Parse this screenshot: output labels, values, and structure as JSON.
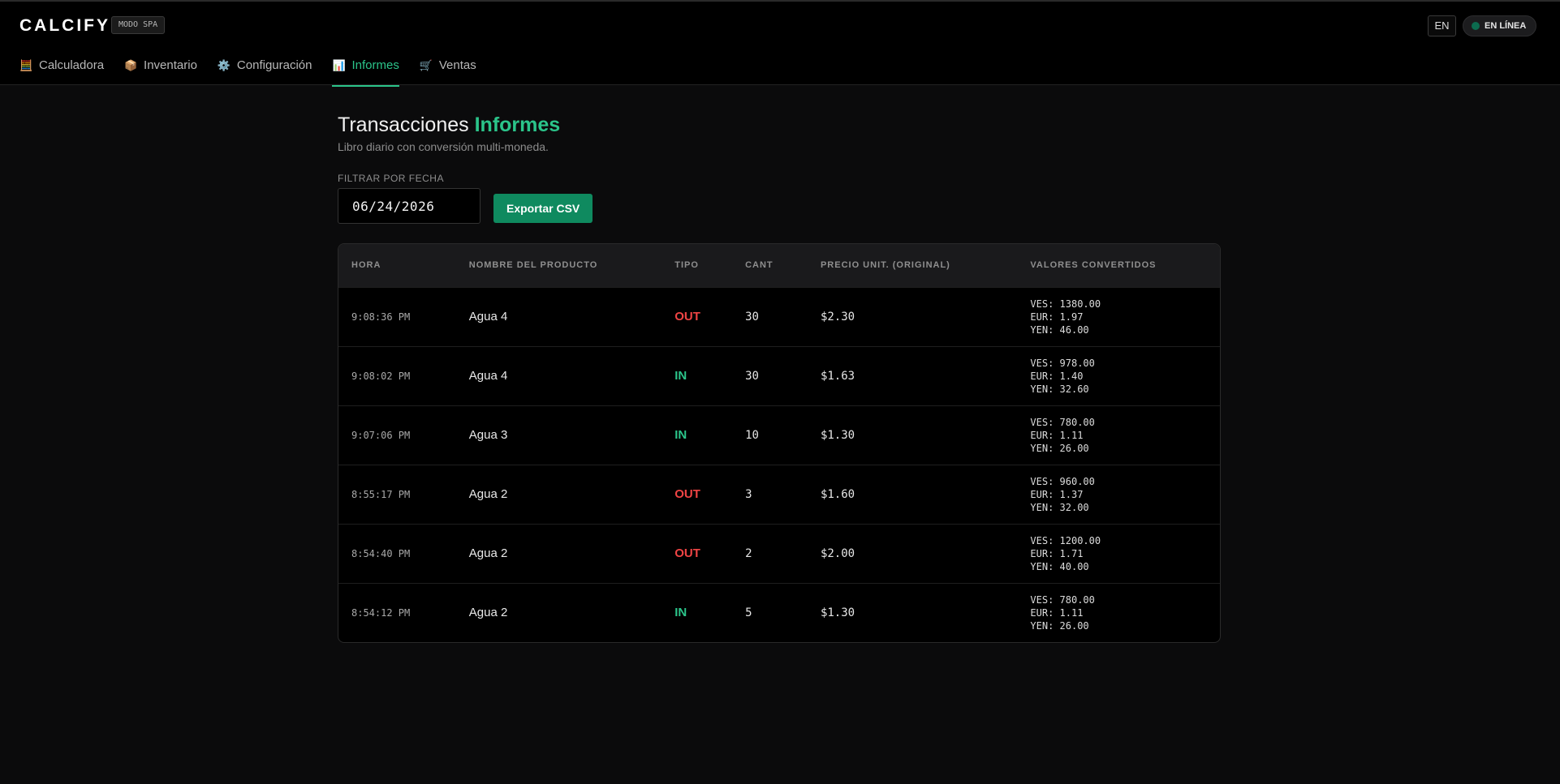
{
  "header": {
    "brand": "CALCIFY",
    "mode_badge": "MODO SPA",
    "lang": "EN",
    "status": "EN LÍNEA"
  },
  "nav": [
    {
      "label": "Calculadora",
      "icon": "🧮",
      "active": false
    },
    {
      "label": "Inventario",
      "icon": "📦",
      "active": false
    },
    {
      "label": "Configuración",
      "icon": "⚙️",
      "active": false
    },
    {
      "label": "Informes",
      "icon": "📊",
      "active": true
    },
    {
      "label": "Ventas",
      "icon": "🛒",
      "active": false
    }
  ],
  "page": {
    "title_main": "Transacciones",
    "title_accent": "Informes",
    "subtitle": "Libro diario con conversión multi-moneda.",
    "filter_label": "FILTRAR POR FECHA",
    "date_value": "06/24/2026",
    "export_label": "Exportar CSV"
  },
  "table": {
    "headers": [
      "HORA",
      "NOMBRE DEL PRODUCTO",
      "TIPO",
      "CANT",
      "PRECIO UNIT. (ORIGINAL)",
      "VALORES CONVERTIDOS"
    ],
    "rows": [
      {
        "time": "9:08:36 PM",
        "product": "Agua 4",
        "type": "OUT",
        "qty": "30",
        "price": "$2.30",
        "conv": [
          "VES: 1380.00",
          "EUR: 1.97",
          "YEN: 46.00"
        ]
      },
      {
        "time": "9:08:02 PM",
        "product": "Agua 4",
        "type": "IN",
        "qty": "30",
        "price": "$1.63",
        "conv": [
          "VES: 978.00",
          "EUR: 1.40",
          "YEN: 32.60"
        ]
      },
      {
        "time": "9:07:06 PM",
        "product": "Agua 3",
        "type": "IN",
        "qty": "10",
        "price": "$1.30",
        "conv": [
          "VES: 780.00",
          "EUR: 1.11",
          "YEN: 26.00"
        ]
      },
      {
        "time": "8:55:17 PM",
        "product": "Agua 2",
        "type": "OUT",
        "qty": "3",
        "price": "$1.60",
        "conv": [
          "VES: 960.00",
          "EUR: 1.37",
          "YEN: 32.00"
        ]
      },
      {
        "time": "8:54:40 PM",
        "product": "Agua 2",
        "type": "OUT",
        "qty": "2",
        "price": "$2.00",
        "conv": [
          "VES: 1200.00",
          "EUR: 1.71",
          "YEN: 40.00"
        ]
      },
      {
        "time": "8:54:12 PM",
        "product": "Agua 2",
        "type": "IN",
        "qty": "5",
        "price": "$1.30",
        "conv": [
          "VES: 780.00",
          "EUR: 1.11",
          "YEN: 26.00"
        ]
      }
    ]
  },
  "colors": {
    "accent": "#2bc48a",
    "out": "#ef4444",
    "export_button": "#0f8a5f"
  }
}
